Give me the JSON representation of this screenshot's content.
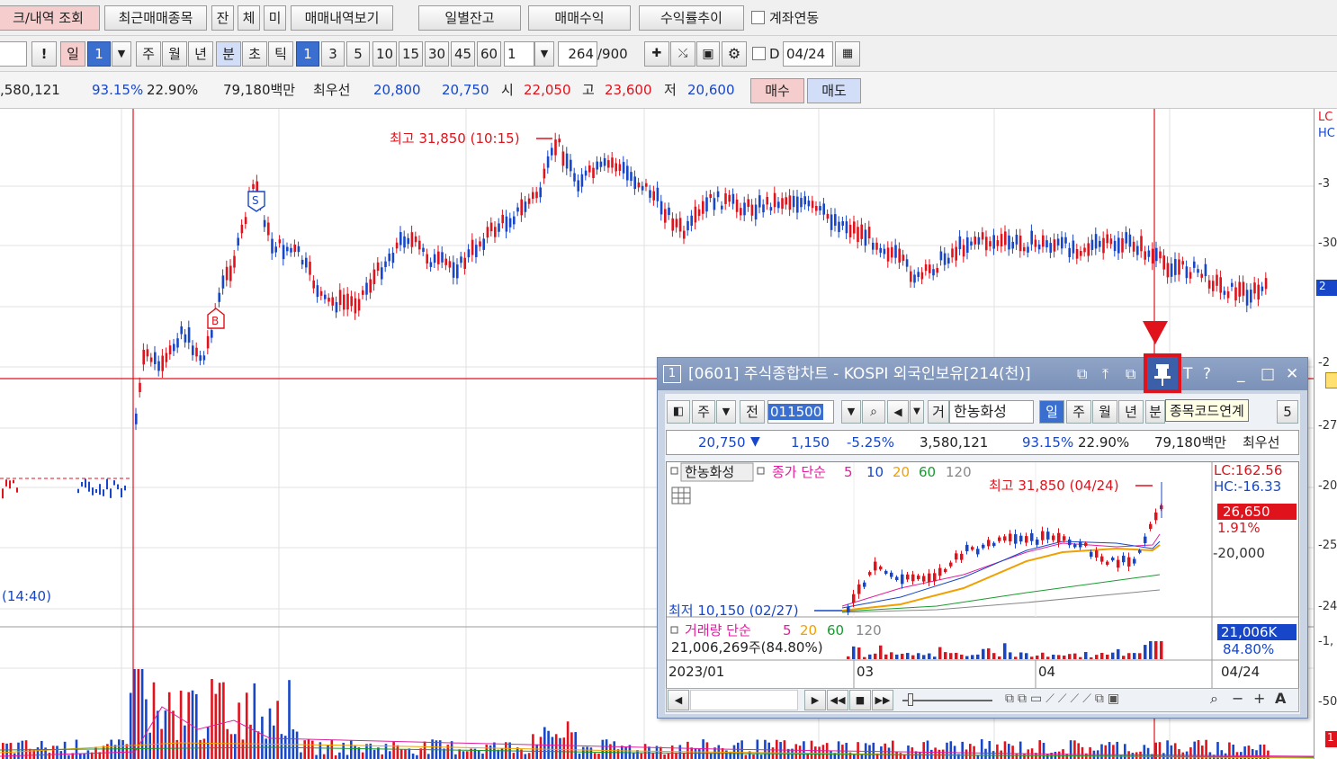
{
  "toolbar1": {
    "buttons": [
      "크/내역 조회",
      "최근매매종목",
      "잔",
      "체",
      "미",
      "매매내역보기",
      "일별잔고",
      "매매수익",
      "수익률추이"
    ],
    "account_link": "계좌연동"
  },
  "toolbar2": {
    "exclaim": "!",
    "day": "일",
    "day_count": "1",
    "periods": [
      "주",
      "월",
      "년",
      "분",
      "초",
      "틱"
    ],
    "intervals": [
      "1",
      "3",
      "5",
      "10",
      "15",
      "30",
      "45",
      "60"
    ],
    "interval_select": "1",
    "count_value": "264",
    "count_max": "/900",
    "date_check_label": "D",
    "date_value": "04/24"
  },
  "quote_bar": {
    "volume": ",580,121",
    "rate1": "93.15%",
    "rate2": "22.90%",
    "amount": "79,180백만",
    "best_label": "최우선",
    "best_ask": "20,800",
    "best_bid": "20,750",
    "open_label": "시",
    "open": "22,050",
    "high_label": "고",
    "high": "23,600",
    "low_label": "저",
    "low": "20,600",
    "buy": "매수",
    "sell": "매도"
  },
  "main_chart": {
    "high_annotation": "최고 31,850 (10:15)",
    "low_annotation": "(14:40)",
    "axis_labels": [
      "LC",
      "HC",
      "-3",
      "-30",
      "-2",
      "-27",
      "-20",
      "-25",
      "-24",
      "-1,",
      "-50",
      "1"
    ],
    "price_badge": "2",
    "signal_sell": "S",
    "signal_buy": "B"
  },
  "popup": {
    "title": "[0601] 주식종합차트 - KOSPI 외국인보유[214(천)]",
    "window_num": "1",
    "tooltip": "종목코드연계",
    "toolbar": {
      "week": "주",
      "prev": "전",
      "code": "011500",
      "name_prefix": "거",
      "name": "한농화성",
      "periods": [
        "일",
        "주",
        "월",
        "년",
        "분"
      ],
      "interval": "5"
    },
    "quote": {
      "price": "20,750",
      "change": "1,150",
      "rate": "-5.25%",
      "volume": "3,580,121",
      "rate1": "93.15%",
      "rate2": "22.90%",
      "amount": "79,180백만",
      "best": "최우선"
    },
    "chart": {
      "legend_name": "한농화성",
      "legend_close": "종가 단순",
      "ma": [
        "5",
        "10",
        "20",
        "60",
        "120"
      ],
      "high_label": "최고 31,850 (04/24)",
      "low_label": "최저 10,150 (02/27)",
      "lc": "LC:162.56",
      "hc": "HC:-16.33",
      "cur_price": "26,650",
      "cur_rate": "1.91%",
      "axis_price": "-20,000"
    },
    "volume": {
      "legend": "거래량 단순",
      "ma": [
        "5",
        "20",
        "60",
        "120"
      ],
      "value": "21,006,269주(84.80%)",
      "badge": "21,006K",
      "badge_rate": "84.80%"
    },
    "dates": [
      "2023/01",
      "03",
      "04",
      "04/24"
    ]
  },
  "colors": {
    "up": "#e0121b",
    "down": "#1747c8",
    "ma5": "#e020a0",
    "ma20": "#f0a000",
    "ma60": "#1a9a30"
  }
}
